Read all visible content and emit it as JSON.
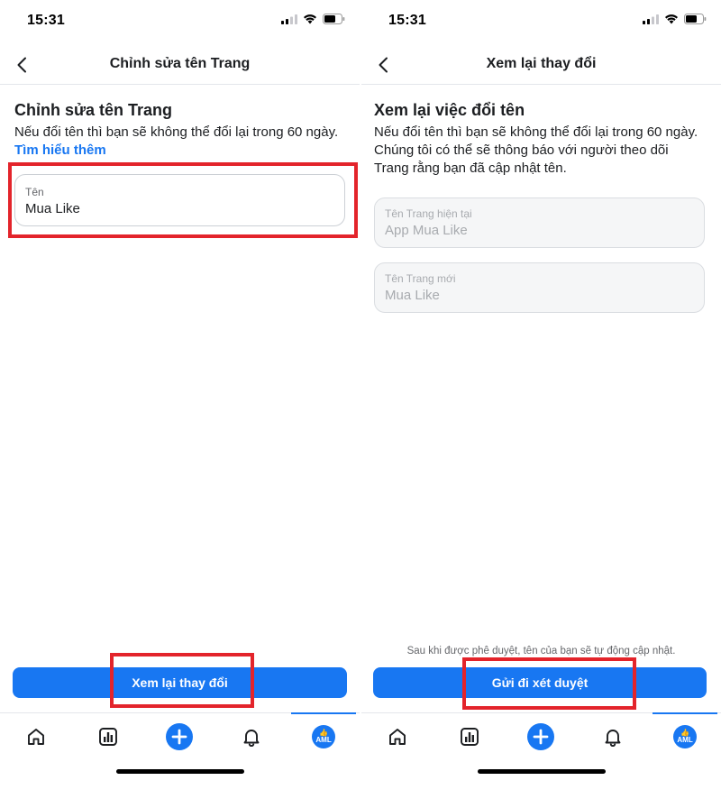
{
  "left": {
    "status": {
      "time": "15:31"
    },
    "header": {
      "title": "Chỉnh sửa tên Trang"
    },
    "heading": "Chỉnh sửa tên Trang",
    "description": "Nếu đổi tên thì bạn sẽ không thể đổi lại trong 60 ngày.",
    "learn_more": "Tìm hiểu thêm",
    "name_field": {
      "label": "Tên",
      "value": "Mua Like"
    },
    "primary_button": "Xem lại thay đổi",
    "avatar_text": "AML"
  },
  "right": {
    "status": {
      "time": "15:31"
    },
    "header": {
      "title": "Xem lại thay đổi"
    },
    "heading": "Xem lại việc đổi tên",
    "description": "Nếu đổi tên thì bạn sẽ không thể đổi lại trong 60 ngày. Chúng tôi có thể sẽ thông báo với người theo dõi Trang rằng bạn đã cập nhật tên.",
    "current_field": {
      "label": "Tên Trang hiện tại",
      "value": "App Mua Like"
    },
    "new_field": {
      "label": "Tên Trang mới",
      "value": "Mua Like"
    },
    "footer_note": "Sau khi được phê duyệt, tên của bạn sẽ tự động cập nhật.",
    "primary_button": "Gửi đi xét duyệt",
    "avatar_text": "AML"
  },
  "colors": {
    "accent": "#1877f2",
    "highlight": "#e3242b",
    "text": "#1c1e21",
    "muted": "#65676b"
  },
  "tab_icons": [
    "home-icon",
    "insights-icon",
    "create-icon",
    "notifications-icon",
    "profile-avatar"
  ]
}
